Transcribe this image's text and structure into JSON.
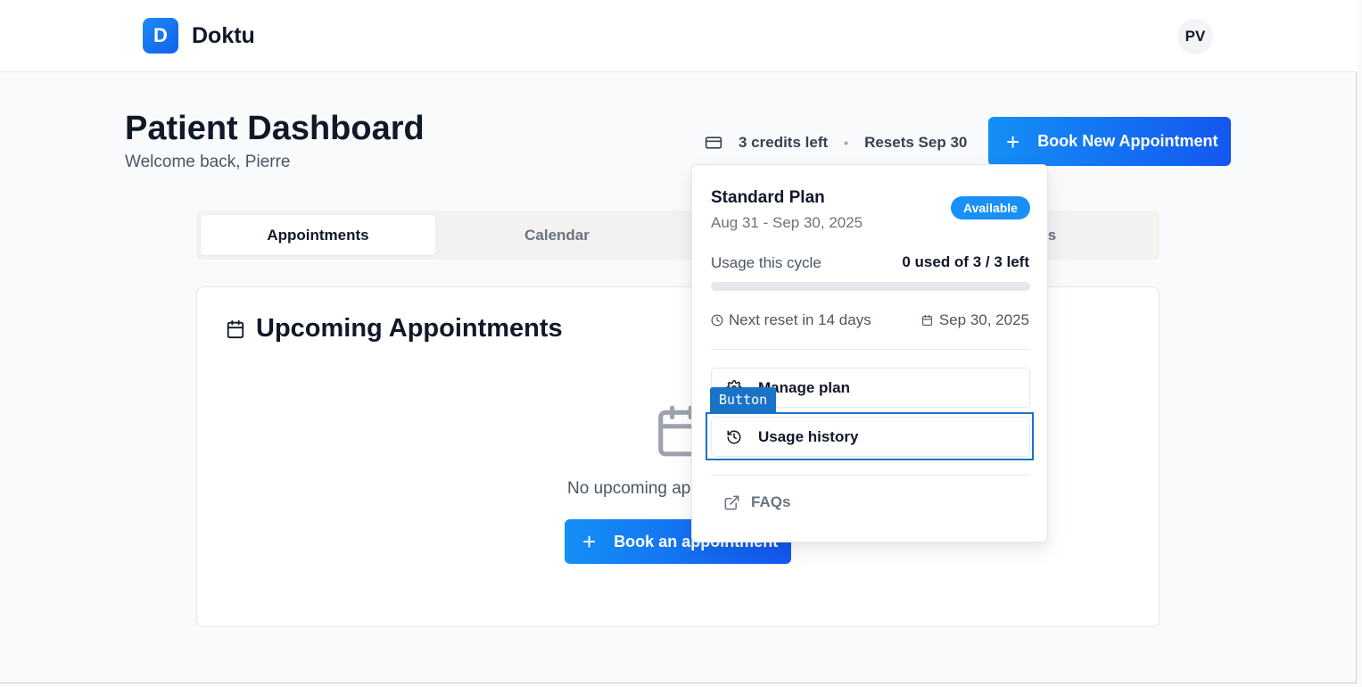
{
  "header": {
    "logo_letter": "D",
    "brand": "Doktu",
    "avatar_initials": "PV"
  },
  "page": {
    "title": "Patient Dashboard",
    "welcome": "Welcome back, Pierre"
  },
  "credits": {
    "icon": "credit-card-icon",
    "left_label": "3 credits left",
    "separator": "•",
    "resets_label": "Resets Sep 30"
  },
  "actions": {
    "book_new_icon": "+",
    "book_new_label": "Book New Appointment"
  },
  "tabs": [
    {
      "label": "Appointments",
      "active": true
    },
    {
      "label": "Calendar",
      "active": false
    },
    {
      "label": "ngs",
      "active": false
    }
  ],
  "card": {
    "title": "Upcoming Appointments",
    "empty_text": "No upcoming ap",
    "book_icon": "+",
    "book_label": "Book an appointment"
  },
  "popover": {
    "plan_name": "Standard Plan",
    "plan_dates": "Aug 31 - Sep 30, 2025",
    "badge": "Available",
    "badge_color": "#1890f5",
    "usage_label": "Usage this cycle",
    "usage_value": "0 used of 3 / 3 left",
    "usage_fraction": 0,
    "next_reset": "Next reset in 14 days",
    "reset_date": "Sep 30, 2025",
    "manage_label": "Manage plan",
    "history_label": "Usage history",
    "faq_label": "FAQs"
  },
  "overlay": {
    "tooltip": "Button",
    "highlight_color": "#1a73c7"
  },
  "colors": {
    "accent_start": "#1490f5",
    "accent_end": "#1457f0"
  }
}
